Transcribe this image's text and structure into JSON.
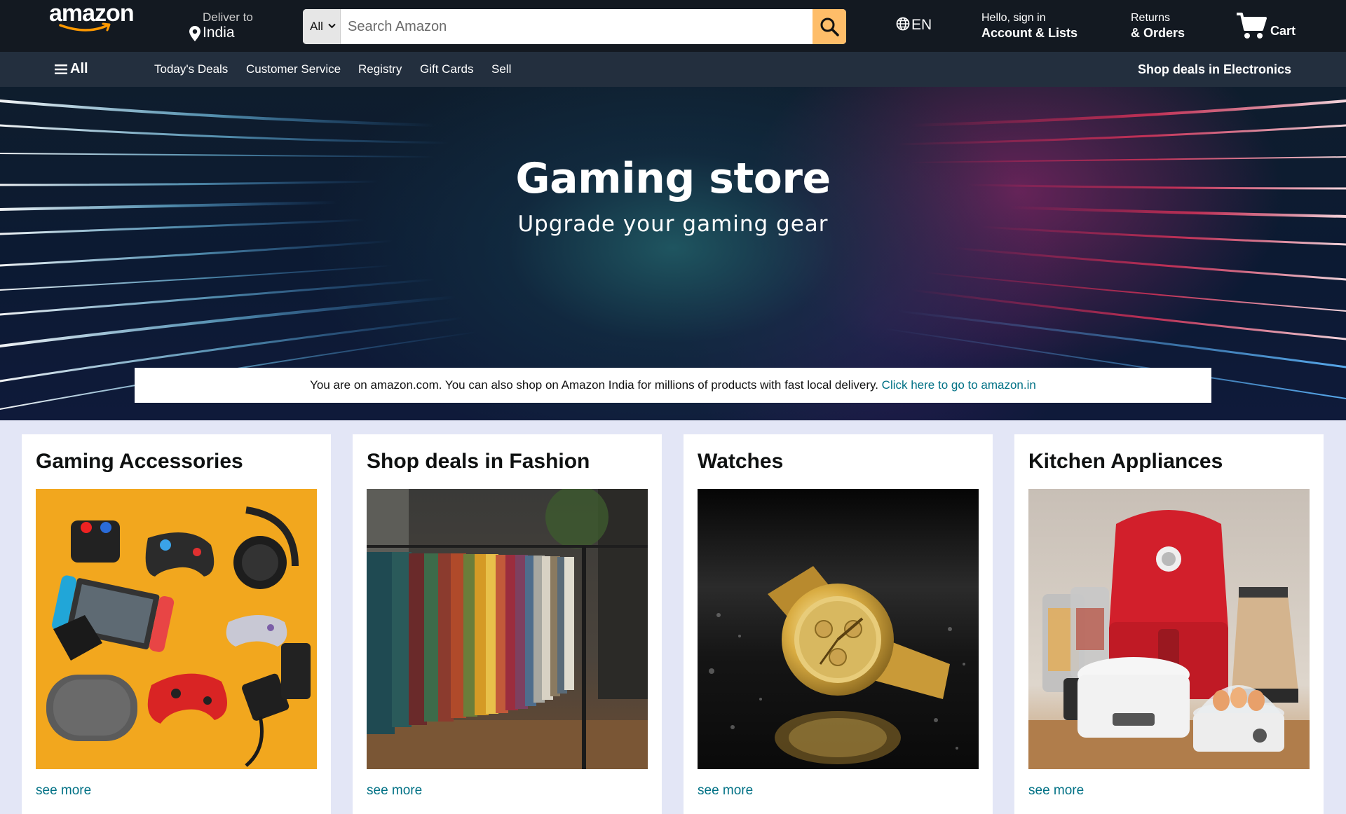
{
  "header": {
    "logo_text": "amazon",
    "deliver_label": "Deliver to",
    "deliver_location": "India",
    "search": {
      "category": "All",
      "placeholder": "Search Amazon"
    },
    "language": "EN",
    "account_line1": "Hello, sign in",
    "account_line2": "Account & Lists",
    "returns_line1": "Returns",
    "returns_line2": "& Orders",
    "cart_label": "Cart"
  },
  "subnav": {
    "all_label": "All",
    "items": [
      {
        "label": "Today's Deals"
      },
      {
        "label": "Customer Service"
      },
      {
        "label": "Registry"
      },
      {
        "label": "Gift Cards"
      },
      {
        "label": "Sell"
      }
    ],
    "promo": "Shop deals in Electronics"
  },
  "hero": {
    "title": "Gaming store",
    "subtitle": "Upgrade your gaming gear"
  },
  "notice": {
    "text": "You are on amazon.com. You can also shop on Amazon India for millions of products with fast local delivery. ",
    "link": "Click here to go to amazon.in"
  },
  "cards": [
    {
      "title": "Gaming Accessories",
      "link": "see more"
    },
    {
      "title": "Shop deals in Fashion",
      "link": "see more"
    },
    {
      "title": "Watches",
      "link": "see more"
    },
    {
      "title": "Kitchen Appliances",
      "link": "see more"
    }
  ],
  "colors": {
    "header_bg": "#131921",
    "subnav_bg": "#232f3e",
    "search_button": "#febd69",
    "link": "#007185",
    "logo_smile": "#ff9900",
    "page_bg": "#e3e6f6"
  }
}
